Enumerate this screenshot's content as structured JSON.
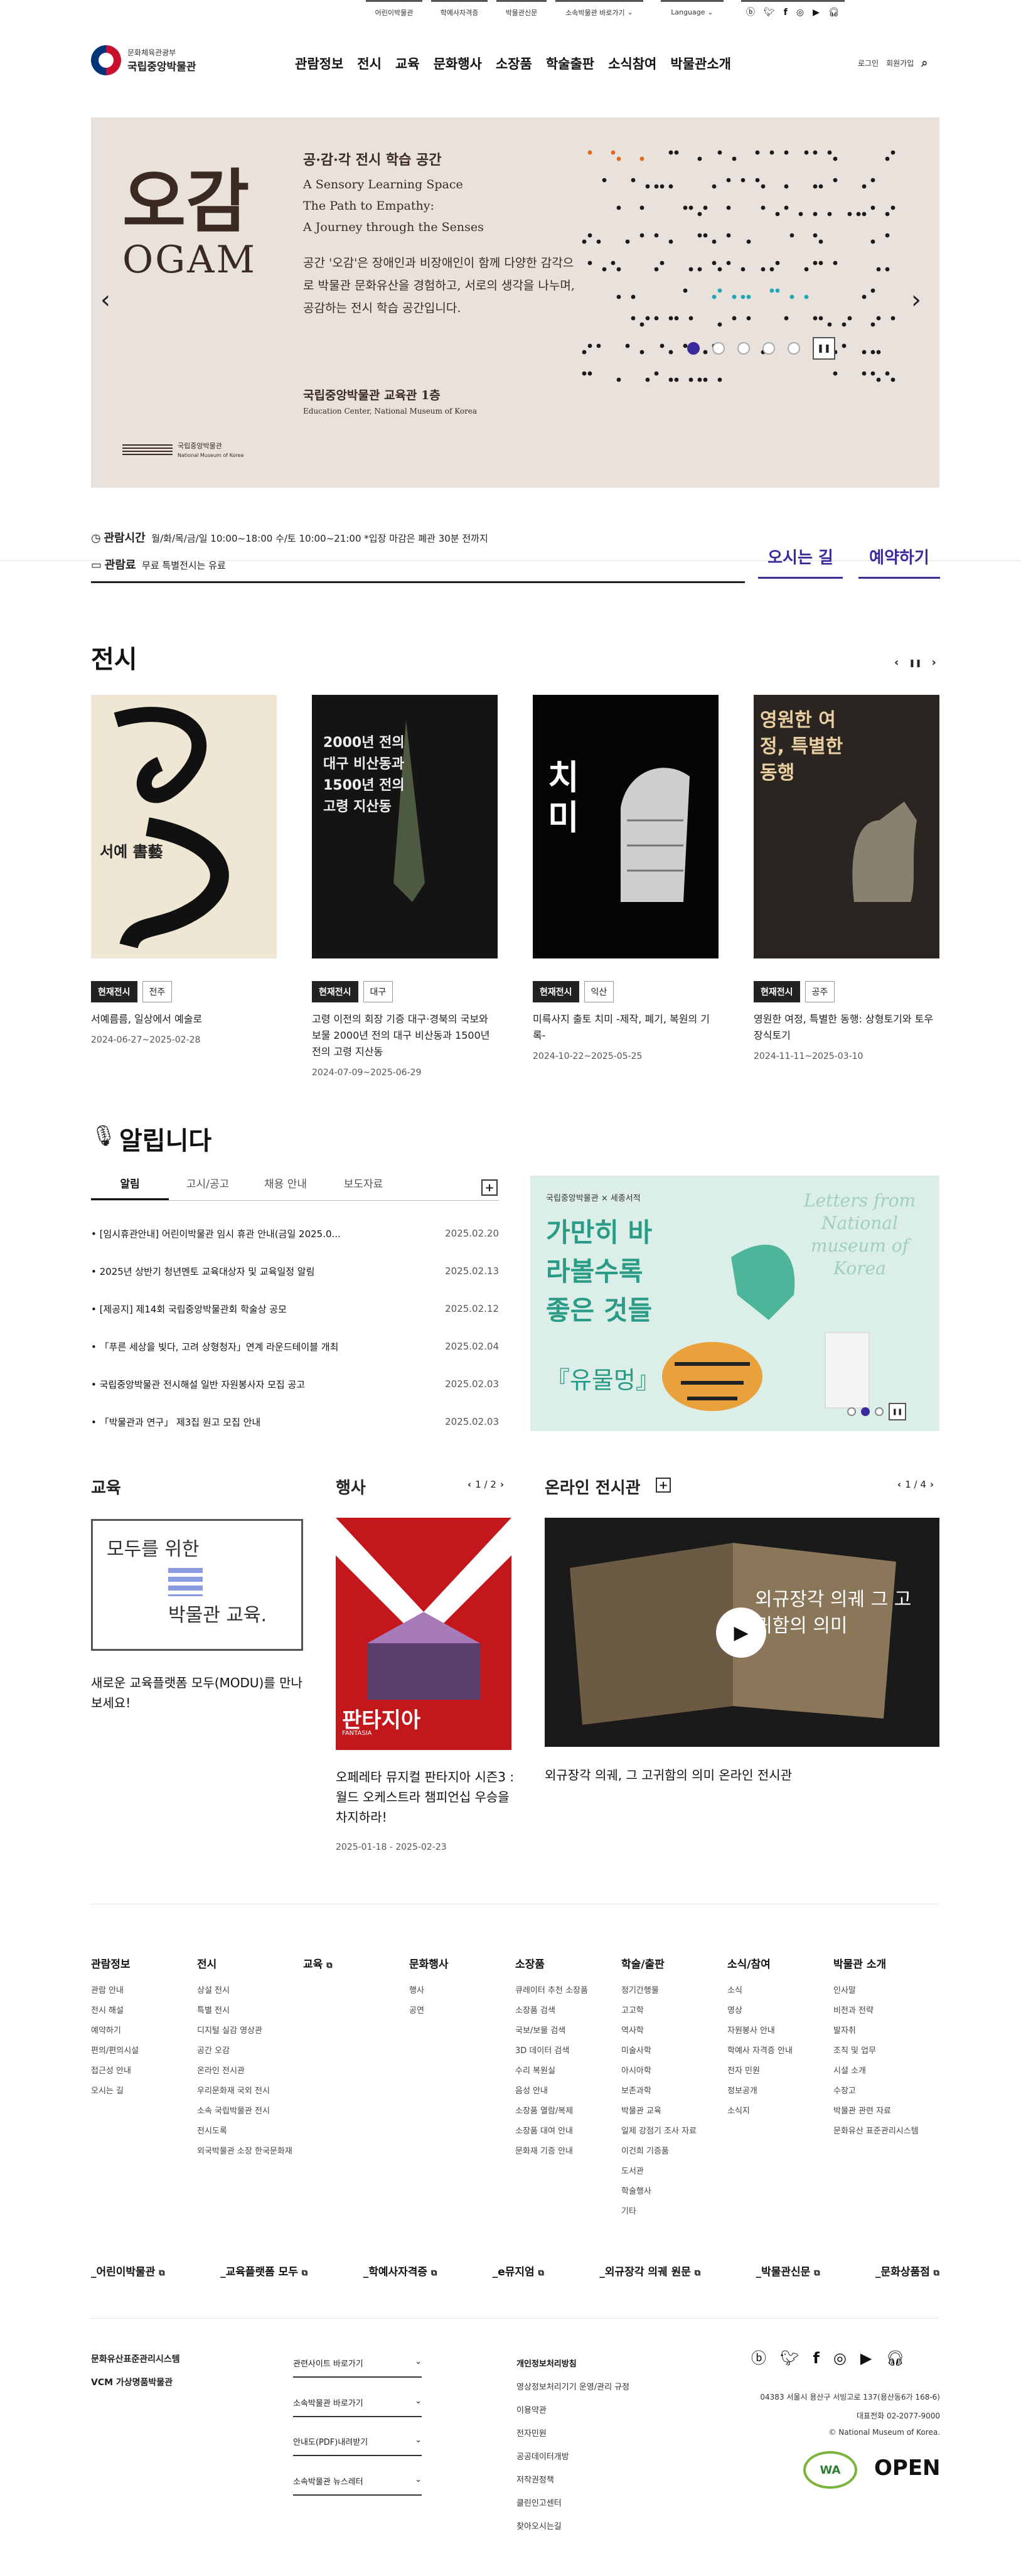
{
  "util": {
    "links": [
      "어린이박물관",
      "학예사자격증",
      "박물관신문",
      "소속박물관 바로가기"
    ],
    "language": "Language",
    "sns": [
      "blog-icon",
      "twitter-icon",
      "facebook-icon",
      "instagram-icon",
      "youtube-icon",
      "podcast-icon"
    ]
  },
  "header": {
    "gov": "문화체육관광부",
    "name": "국립중앙박물관",
    "menu": [
      "관람정보",
      "전시",
      "교육",
      "문화행사",
      "소장품",
      "학술출판",
      "소식참여",
      "박물관소개"
    ],
    "login": "로그인",
    "join": "회원가입"
  },
  "hero": {
    "big": "오감",
    "eng": "OGAM",
    "heading": "공·감·각 전시 학습 공간",
    "sub": [
      "A Sensory Learning Space",
      "The Path to Empathy:",
      "A Journey through the Senses"
    ],
    "desc": "공간 '오감'은 장애인과 비장애인이 함께 다양한 감각으로 박물관 문화유산을 경험하고, 서로의 생각을 나누며, 공감하는 전시 학습 공간입니다.",
    "loc": "국립중앙박물관 교육관 1층",
    "loc_en": "Education Center, National Museum of Korea",
    "mus": "국립중앙박물관",
    "mus_en": "National Museum of Korea",
    "slides": 5,
    "active": 0
  },
  "info": {
    "hours_label": "관람시간",
    "hours": "월/화/목/금/일  10:00~18:00  수/토  10:00~21:00  *입장 마감은 폐관 30분 전까지",
    "fee_label": "관람료",
    "fee": "무료  특별전시는 유료",
    "directions": "오시는 길",
    "reserve": "예약하기"
  },
  "exhibit": {
    "title": "전시",
    "cards": [
      {
        "badge": "현재전시",
        "place": "전주",
        "title": "서예름름, 일상에서 예술로",
        "date": "2024-06-27~2025-02-28",
        "poster": "서예 書藝"
      },
      {
        "badge": "현재전시",
        "place": "대구",
        "title": "고령 이전의 회장 기증 대구·경북의 국보와 보물 2000년 전의 대구 비산동과 1500년 전의 고령 지산동",
        "date": "2024-07-09~2025-06-29",
        "poster": "2000년 전의 대구 비산동과 1500년 전의 고령 지산동"
      },
      {
        "badge": "현재전시",
        "place": "익산",
        "title": "미륵사지 출토 치미 -제작, 폐기, 복원의 기록-",
        "date": "2024-10-22~2025-05-25",
        "poster": "치미"
      },
      {
        "badge": "현재전시",
        "place": "공주",
        "title": "영원한 여정, 특별한 동행: 상형토기와 토우장식토기",
        "date": "2024-11-11~2025-03-10",
        "poster": "영원한 여정, 특별한 동행"
      }
    ]
  },
  "notice": {
    "title": "알립니다",
    "tabs": [
      "알림",
      "고시/공고",
      "채용 안내",
      "보도자료"
    ],
    "items": [
      {
        "t": "[임시휴관안내] 어린이박물관 임시 휴관 안내(금일 2025.0...",
        "d": "2025.02.20"
      },
      {
        "t": "2025년 상반기 청년멘토 교육대상자 및 교육일정 알림",
        "d": "2025.02.13"
      },
      {
        "t": "[제공지] 제14회 국립중앙박물관회 학술상 공모",
        "d": "2025.02.12"
      },
      {
        "t": "「푸른 세상을 빚다, 고려 상형청자」연계 라운드테이블 개최",
        "d": "2025.02.04"
      },
      {
        "t": "국립중앙박물관 전시해설 일반 자원봉사자 모집 공고",
        "d": "2025.02.03"
      },
      {
        "t": "「박물관과 연구」 제3집 원고 모집 안내",
        "d": "2025.02.03"
      }
    ],
    "banner": {
      "top": "국립중앙박물관 × 세종서적",
      "main": "가만히 바라볼수록 좋은 것들",
      "sub": "『유물멍』",
      "en": "Letters from National museum of Korea"
    }
  },
  "edu": {
    "title": "교육",
    "box1": "모두를 위한",
    "box2": "박물관 교육.",
    "desc": "새로운 교육플랫폼 모두(MODU)를 만나보세요!"
  },
  "event": {
    "title": "행사",
    "page": "1 / 2",
    "img": "판타지아",
    "img_en": "FANTASIA",
    "desc": "오페레타 뮤지컬 판타지아 시즌3 : 월드 오케스트라 챔피언십 우승을 차지하라!",
    "date": "2025-01-18 - 2025-02-23"
  },
  "online": {
    "title": "온라인 전시관",
    "page": "1 / 4",
    "img": "외규장각 의궤 그 고귀함의 의미",
    "desc": "외규장각 의궤, 그 고귀함의 의미 온라인 전시관"
  },
  "sitemap": [
    {
      "h": "관람정보",
      "i": [
        "관람 안내",
        "전시 해설",
        "예약하기",
        "편의/편의시설",
        "접근성 안내",
        "오시는 길"
      ]
    },
    {
      "h": "전시",
      "i": [
        "상설 전시",
        "특별 전시",
        "디지털 실감 영상관",
        "공간 오감",
        "온라인 전시관",
        "우리문화재 국외 전시",
        "소속 국립박물관 전시",
        "전시도록",
        "외국박물관 소장 한국문화재"
      ]
    },
    {
      "h": "교육",
      "i": []
    },
    {
      "h": "문화행사",
      "i": [
        "행사",
        "공연"
      ]
    },
    {
      "h": "소장품",
      "i": [
        "큐레이터 추천 소장품",
        "소장품 검색",
        "국보/보물 검색",
        "3D 데이터 검색",
        "수리 복원실",
        "음성 안내",
        "소장품 열람/복제",
        "소장품 대여 안내",
        "문화재 기증 안내"
      ]
    },
    {
      "h": "학술/출판",
      "i": [
        "정기간행물",
        "고고학",
        "역사학",
        "미술사학",
        "아시아학",
        "보존과학",
        "박물관 교육",
        "일제 강점기 조사 자료",
        "이건희 기증품",
        "도서관",
        "학술행사",
        "기타"
      ]
    },
    {
      "h": "소식/참여",
      "i": [
        "소식",
        "영상",
        "자원봉사 안내",
        "학예사 자격증 안내",
        "전자 민원",
        "정보공개",
        "소식지"
      ]
    },
    {
      "h": "박물관 소개",
      "i": [
        "인사말",
        "비전과 전략",
        "발자취",
        "조직 및 업무",
        "시설 소개",
        "수장고",
        "박물관 관련 자료",
        "문화유산 표준관리시스템"
      ]
    }
  ],
  "quicklinks": [
    "_어린이박물관",
    "_교육플랫폼 모두",
    "_학예사자격증",
    "_e뮤지엄",
    "_외규장각 의궤 원문",
    "_박물관신문",
    "_문화상품점"
  ],
  "footer": {
    "left": [
      "문화유산표준관리시스템",
      "VCM 가상명품박물관"
    ],
    "selects": [
      "관련사이트 바로가기",
      "소속박물관 바로가기",
      "안내도(PDF)내려받기",
      "소속박물관 뉴스레터"
    ],
    "policy": [
      "개인정보처리방침",
      "영상정보처리기기 운영/관리 규정",
      "이용약관",
      "전자민원",
      "공공데이터개방",
      "저작권정책",
      "클린인고센터",
      "찾아오시는길"
    ],
    "address": "04383 서울시 용산구 서빙고로 137(용산동6가 168-6)",
    "tel": "대표전화 02-2077-9000",
    "copy": "© National Museum of Korea.",
    "badge1": "WA",
    "badge2": "OPEN"
  }
}
